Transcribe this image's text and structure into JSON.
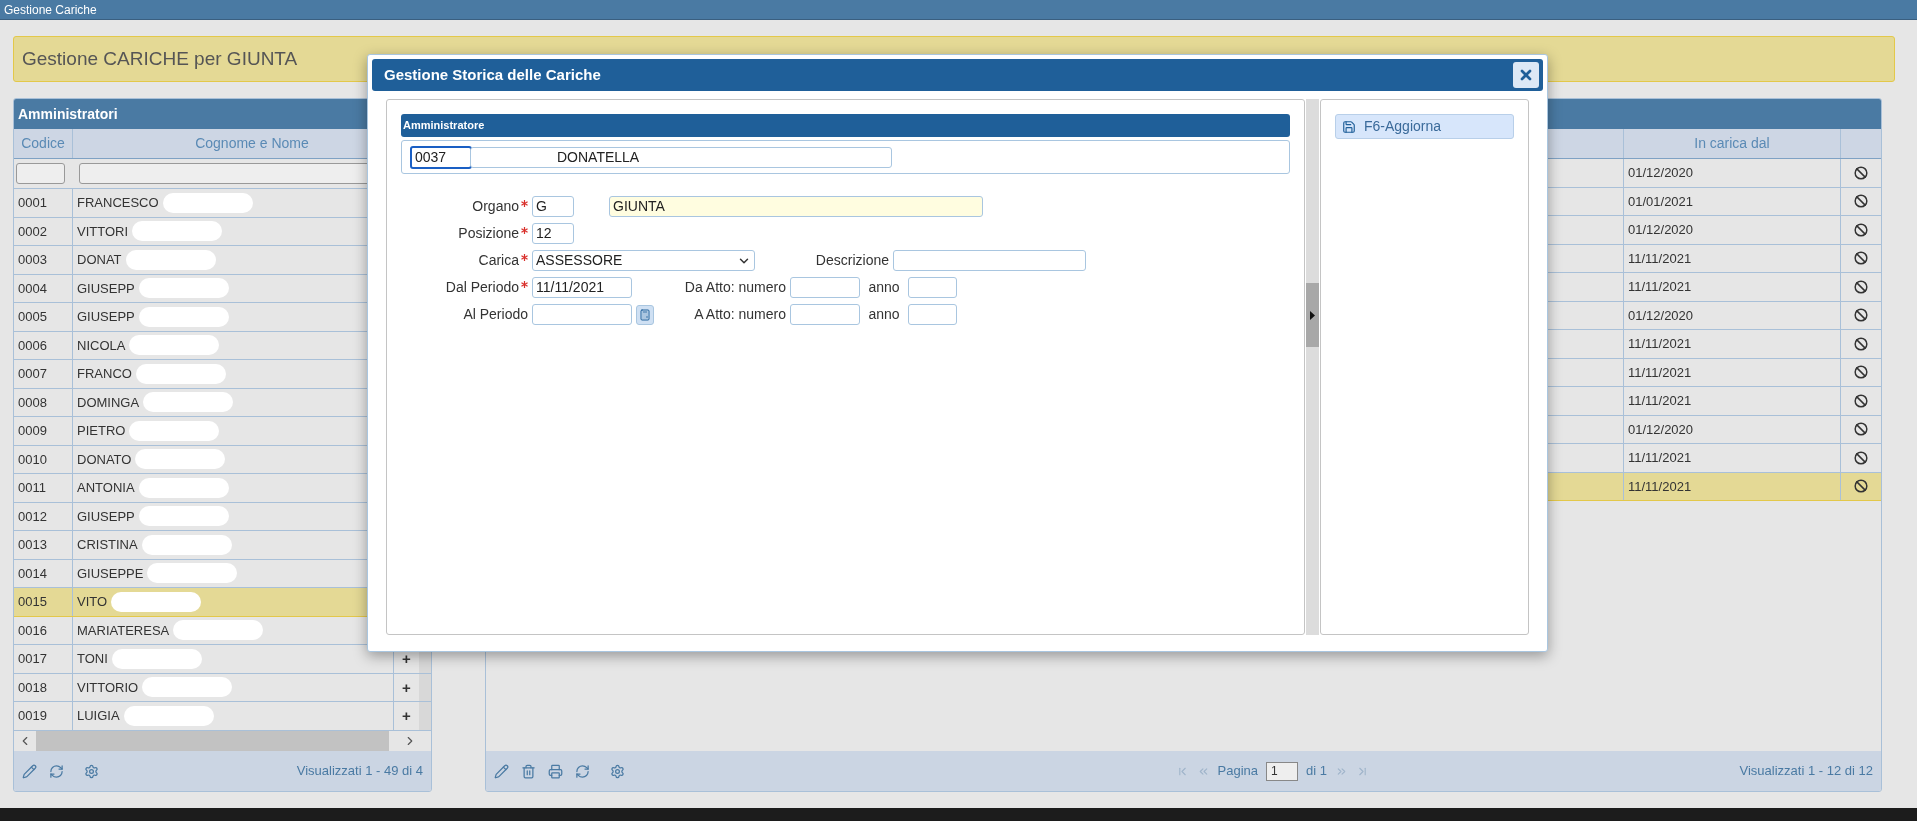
{
  "window": {
    "title": "Gestione Cariche"
  },
  "page_header": {
    "title": "Gestione CARICHE per GIUNTA"
  },
  "administrators": {
    "title": "Amministratori",
    "columns": [
      "Codice",
      "Cognome e Nome"
    ],
    "rows": [
      {
        "code": "0001",
        "name": "FRANCESCO",
        "redacted": true,
        "selected": false
      },
      {
        "code": "0002",
        "name": "VITTORI",
        "redacted": true,
        "selected": false
      },
      {
        "code": "0003",
        "name": "DONAT",
        "redacted": true,
        "selected": false
      },
      {
        "code": "0004",
        "name": "GIUSEPP",
        "redacted": true,
        "selected": false
      },
      {
        "code": "0005",
        "name": "GIUSEPP",
        "redacted": true,
        "selected": false
      },
      {
        "code": "0006",
        "name": "NICOLA",
        "redacted": true,
        "selected": false
      },
      {
        "code": "0007",
        "name": "FRANCO",
        "redacted": true,
        "selected": false
      },
      {
        "code": "0008",
        "name": "DOMINGA",
        "redacted": true,
        "selected": false
      },
      {
        "code": "0009",
        "name": "PIETRO",
        "redacted": true,
        "selected": false
      },
      {
        "code": "0010",
        "name": "DONATO",
        "redacted": true,
        "selected": false
      },
      {
        "code": "0011",
        "name": "ANTONIA",
        "redacted": true,
        "selected": false
      },
      {
        "code": "0012",
        "name": "GIUSEPP",
        "redacted": true,
        "selected": false
      },
      {
        "code": "0013",
        "name": "CRISTINA",
        "redacted": true,
        "selected": false
      },
      {
        "code": "0014",
        "name": "GIUSEPPE",
        "redacted": true,
        "selected": false
      },
      {
        "code": "0015",
        "name": "VITO",
        "redacted": true,
        "selected": true
      },
      {
        "code": "0016",
        "name": "MARIATERESA",
        "redacted": true,
        "selected": false
      },
      {
        "code": "0017",
        "name": "TONI",
        "redacted": true,
        "selected": false,
        "action": "+"
      },
      {
        "code": "0018",
        "name": "VITTORIO",
        "redacted": true,
        "selected": false,
        "action": "+"
      },
      {
        "code": "0019",
        "name": "LUIGIA",
        "redacted": true,
        "selected": false,
        "action": "+"
      }
    ],
    "footer": "Visualizzati 1 - 49 di 4"
  },
  "charges": {
    "columns": [
      "In carica dal"
    ],
    "rows": [
      {
        "start": "01/12/2020",
        "selected": false
      },
      {
        "start": "01/01/2021",
        "selected": false
      },
      {
        "start": "01/12/2020",
        "selected": false
      },
      {
        "start": "11/11/2021",
        "selected": false
      },
      {
        "start": "11/11/2021",
        "selected": false
      },
      {
        "start": "01/12/2020",
        "selected": false
      },
      {
        "start": "11/11/2021",
        "selected": false
      },
      {
        "start": "11/11/2021",
        "selected": false
      },
      {
        "start": "11/11/2021",
        "selected": false
      },
      {
        "start": "01/12/2020",
        "selected": false
      },
      {
        "start": "11/11/2021",
        "selected": false
      },
      {
        "start": "11/11/2021",
        "selected": true
      }
    ],
    "pager": {
      "label": "Pagina",
      "page": "1",
      "of": "di 1"
    },
    "footer": "Visualizzati 1 - 12 di 12"
  },
  "dialog": {
    "title": "Gestione Storica delle Cariche",
    "section": "Amministratore",
    "code": "0037",
    "name": "DONATELLA",
    "form": {
      "organo": {
        "label": "Organo",
        "required": true,
        "code": "G",
        "description": "GIUNTA"
      },
      "posizione": {
        "label": "Posizione",
        "required": true,
        "value": "12"
      },
      "carica": {
        "label": "Carica",
        "required": true,
        "value": "ASSESSORE"
      },
      "descrizione": {
        "label": "Descrizione",
        "required": false
      },
      "dal_periodo": {
        "label": "Dal Periodo",
        "required": true,
        "value": "11/11/2021"
      },
      "al_periodo": {
        "label": "Al Periodo",
        "required": false
      },
      "da_atto": {
        "label": "Da Atto: numero",
        "year_label": "anno"
      },
      "a_atto": {
        "label": "A Atto: numero",
        "year_label": "anno"
      }
    },
    "actions": [
      {
        "label": "F6-Aggiorna"
      }
    ]
  }
}
